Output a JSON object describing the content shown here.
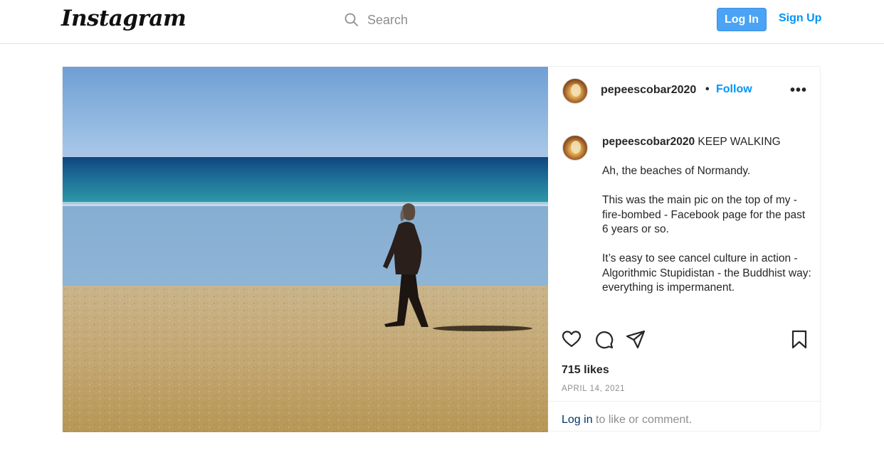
{
  "header": {
    "logo": "Instagram",
    "search_placeholder": "Search",
    "login_label": "Log In",
    "signup_label": "Sign Up",
    "accent_color": "#0095f6"
  },
  "post": {
    "username": "pepeescobar2020",
    "follow_label": "Follow",
    "separator": "•",
    "more_label": "•••",
    "caption_title": "KEEP WALKING",
    "caption_paragraphs": [
      "Ah, the beaches of Normandy.",
      "This was the main pic on the top of my - fire-bombed - Facebook page for the past 6 years or so.",
      "It’s easy to see cancel culture in action - Algorithmic Stupidistan - the Buddhist way: everything is impermanent."
    ],
    "likes": "715 likes",
    "date": "APRIL 14, 2021",
    "login_link": "Log in",
    "login_suffix": " to like or comment.",
    "icons": [
      "search-icon",
      "heart-icon",
      "comment-icon",
      "share-icon",
      "bookmark-icon",
      "more-icon"
    ]
  }
}
